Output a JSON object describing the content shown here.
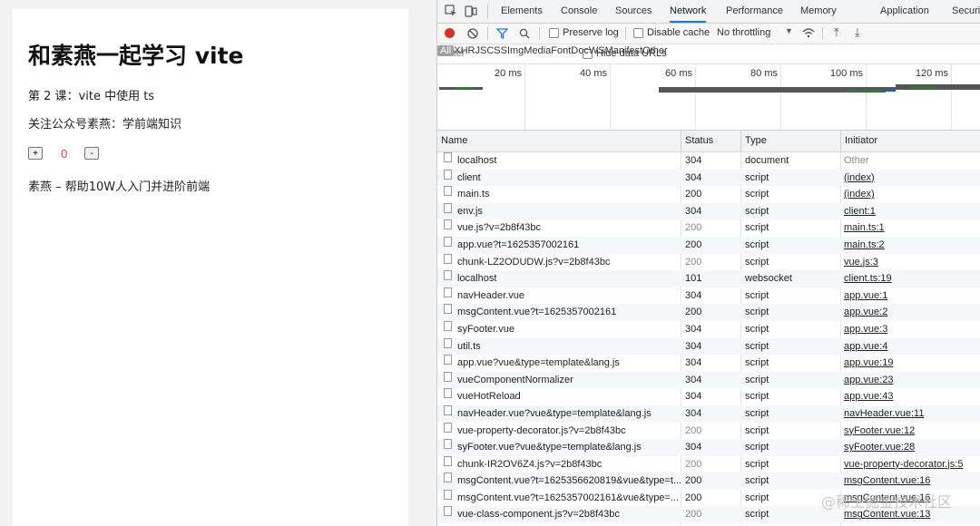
{
  "page": {
    "title": "和素燕一起学习 vite",
    "lesson": "第 2 课：vite 中使用 ts",
    "follow": "关注公众号素燕：学前端知识",
    "counter": {
      "plus": "+",
      "value": "0",
      "minus": "-"
    },
    "footer": "素燕 – 帮助10W人入门并进阶前端"
  },
  "devtools": {
    "tabs": [
      "Elements",
      "Console",
      "Sources",
      "Network",
      "Performance",
      "Memory",
      "Application",
      "Security"
    ],
    "active_tab": "Network",
    "toolbar": {
      "preserve_log": "Preserve log",
      "disable_cache": "Disable cache",
      "throttling": "No throttling"
    },
    "filter": {
      "placeholder": "Filter",
      "hide_data_urls": "Hide data URLs",
      "types": [
        "All",
        "XHR",
        "JS",
        "CSS",
        "Img",
        "Media",
        "Font",
        "Doc",
        "WS",
        "Manifest",
        "Other"
      ]
    },
    "timeline_ticks": [
      "20 ms",
      "40 ms",
      "60 ms",
      "80 ms",
      "100 ms",
      "120 ms"
    ],
    "columns": [
      "Name",
      "Status",
      "Type",
      "Initiator"
    ],
    "rows": [
      {
        "name": "localhost",
        "status": "304",
        "type": "document",
        "initiator": "Other",
        "link": false,
        "grey": false
      },
      {
        "name": "client",
        "status": "304",
        "type": "script",
        "initiator": "(index)",
        "link": true,
        "grey": false
      },
      {
        "name": "main.ts",
        "status": "200",
        "type": "script",
        "initiator": "(index)",
        "link": true,
        "grey": false
      },
      {
        "name": "env.js",
        "status": "304",
        "type": "script",
        "initiator": "client:1",
        "link": true,
        "grey": false
      },
      {
        "name": "vue.js?v=2b8f43bc",
        "status": "200",
        "type": "script",
        "initiator": "main.ts:1",
        "link": true,
        "grey": true
      },
      {
        "name": "app.vue?t=1625357002161",
        "status": "200",
        "type": "script",
        "initiator": "main.ts:2",
        "link": true,
        "grey": false
      },
      {
        "name": "chunk-LZ2ODUDW.js?v=2b8f43bc",
        "status": "200",
        "type": "script",
        "initiator": "vue.js:3",
        "link": true,
        "grey": true
      },
      {
        "name": "localhost",
        "status": "101",
        "type": "websocket",
        "initiator": "client.ts:19",
        "link": true,
        "grey": false
      },
      {
        "name": "navHeader.vue",
        "status": "304",
        "type": "script",
        "initiator": "app.vue:1",
        "link": true,
        "grey": false
      },
      {
        "name": "msgContent.vue?t=1625357002161",
        "status": "200",
        "type": "script",
        "initiator": "app.vue:2",
        "link": true,
        "grey": false
      },
      {
        "name": "syFooter.vue",
        "status": "304",
        "type": "script",
        "initiator": "app.vue:3",
        "link": true,
        "grey": false
      },
      {
        "name": "util.ts",
        "status": "304",
        "type": "script",
        "initiator": "app.vue:4",
        "link": true,
        "grey": false
      },
      {
        "name": "app.vue?vue&type=template&lang.js",
        "status": "304",
        "type": "script",
        "initiator": "app.vue:19",
        "link": true,
        "grey": false
      },
      {
        "name": "vueComponentNormalizer",
        "status": "304",
        "type": "script",
        "initiator": "app.vue:23",
        "link": true,
        "grey": false
      },
      {
        "name": "vueHotReload",
        "status": "304",
        "type": "script",
        "initiator": "app.vue:43",
        "link": true,
        "grey": false
      },
      {
        "name": "navHeader.vue?vue&type=template&lang.js",
        "status": "304",
        "type": "script",
        "initiator": "navHeader.vue:11",
        "link": true,
        "grey": false
      },
      {
        "name": "vue-property-decorator.js?v=2b8f43bc",
        "status": "200",
        "type": "script",
        "initiator": "syFooter.vue:12",
        "link": true,
        "grey": true
      },
      {
        "name": "syFooter.vue?vue&type=template&lang.js",
        "status": "304",
        "type": "script",
        "initiator": "syFooter.vue:28",
        "link": true,
        "grey": false
      },
      {
        "name": "chunk-IR2OV6Z4.js?v=2b8f43bc",
        "status": "200",
        "type": "script",
        "initiator": "vue-property-decorator.js:5",
        "link": true,
        "grey": true
      },
      {
        "name": "msgContent.vue?t=1625356620819&vue&type=t...",
        "status": "200",
        "type": "script",
        "initiator": "msgContent.vue:16",
        "link": true,
        "grey": false
      },
      {
        "name": "msgContent.vue?t=1625357002161&vue&type=...",
        "status": "200",
        "type": "script",
        "initiator": "msgContent.vue:16",
        "link": true,
        "grey": false
      },
      {
        "name": "vue-class-component.js?v=2b8f43bc",
        "status": "200",
        "type": "script",
        "initiator": "msgContent.vue:13",
        "link": true,
        "grey": true
      }
    ]
  },
  "watermark": "@稀土掘金技术社区",
  "colors": {
    "accent": "#1a73e8",
    "record": "#d93025",
    "counter_value": "#e53935"
  }
}
